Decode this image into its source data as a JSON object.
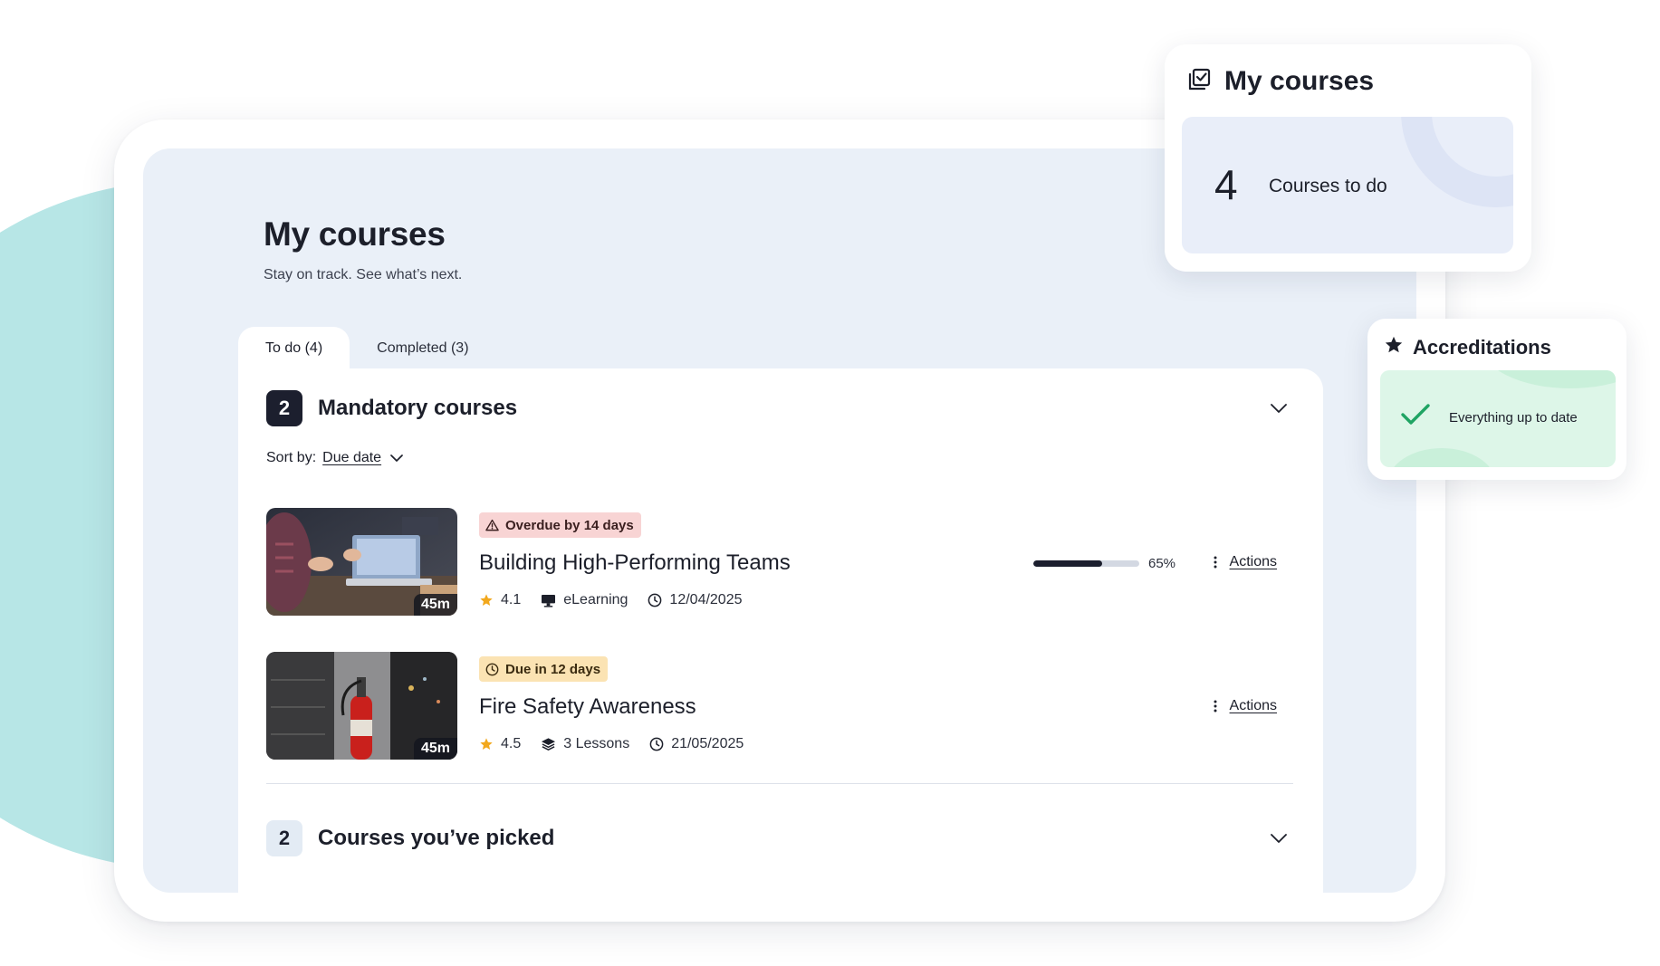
{
  "page": {
    "title": "My courses",
    "subtitle": "Stay on track. See what’s next."
  },
  "tabs": [
    {
      "label": "To do (4)",
      "active": true
    },
    {
      "label": "Completed (3)",
      "active": false
    }
  ],
  "mandatory": {
    "count": "2",
    "title": "Mandatory courses",
    "sort_label": "Sort by:",
    "sort_value": "Due date"
  },
  "courses": [
    {
      "tag": "Overdue by 14 days",
      "tag_type": "overdue",
      "title": "Building High-Performing Teams",
      "duration": "45m",
      "rating": "4.1",
      "format": "eLearning",
      "date": "12/04/2025",
      "progress_percent": 65,
      "progress_label": "65%",
      "actions_label": "Actions"
    },
    {
      "tag": "Due in 12 days",
      "tag_type": "due",
      "title": "Fire Safety Awareness",
      "duration": "45m",
      "rating": "4.5",
      "format": "3 Lessons",
      "date": "21/05/2025",
      "actions_label": "Actions"
    }
  ],
  "picked": {
    "count": "2",
    "title": "Courses you’ve picked"
  },
  "summary_card": {
    "title": "My courses",
    "count": "4",
    "label": "Courses to do"
  },
  "accreditations_card": {
    "title": "Accreditations",
    "status": "Everything up to date"
  },
  "colors": {
    "accent_dark": "#1c1f2e",
    "screen_bg": "#eaf0f8",
    "teal": "#b7e6e6",
    "overdue_tag": "#f8d4d4",
    "due_tag": "#fbe3b3",
    "success": "#1fa463",
    "star": "#f2a81d"
  },
  "icons": {
    "overdue": "warning-triangle-icon",
    "due": "clock-icon",
    "rating": "star-icon",
    "elearning": "monitor-icon",
    "lessons": "layers-icon",
    "date": "clock-icon",
    "actions": "kebab-icon",
    "expand": "chevron-down-icon",
    "my_courses": "checklist-icon",
    "accreditations": "star-icon",
    "status_ok": "checkmark-icon"
  }
}
